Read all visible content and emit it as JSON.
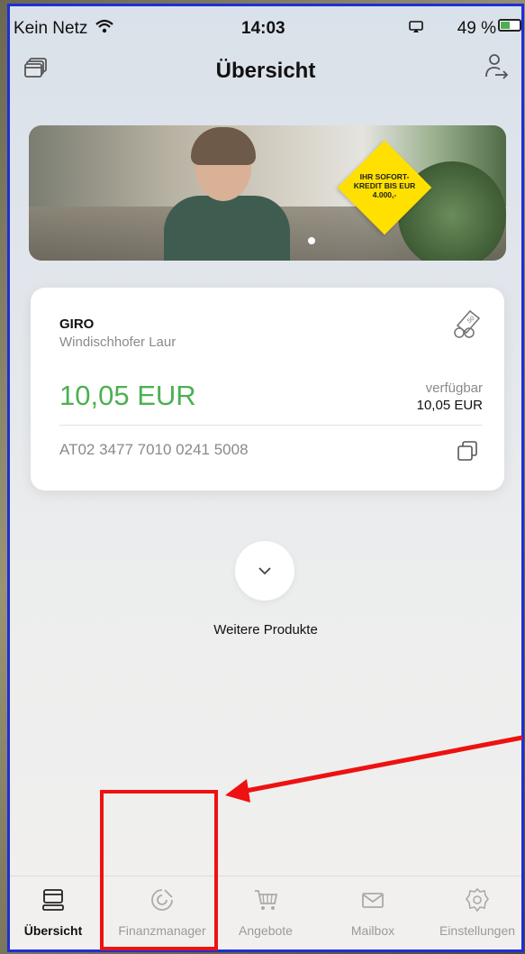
{
  "status_bar": {
    "network": "Kein Netz",
    "time": "14:03",
    "battery": "49 %"
  },
  "header": {
    "title": "Übersicht",
    "left_icon": "accounts-icon",
    "right_icon": "logout-icon"
  },
  "banner": {
    "badge_text": "IHR SOFORT-KREDIT BIS EUR 4.000,-"
  },
  "account": {
    "type": "GIRO",
    "owner": "Windischhofer Laur",
    "balance": "10,05 EUR",
    "available_label": "verfügbar",
    "available_value": "10,05 EUR",
    "iban": "AT02 3477 7010 0241 5008"
  },
  "more_products": {
    "label": "Weitere Produkte"
  },
  "tabbar": {
    "items": [
      {
        "label": "Übersicht",
        "icon": "overview-icon",
        "active": true
      },
      {
        "label": "Finanzmanager",
        "icon": "finance-manager-icon",
        "active": false
      },
      {
        "label": "Angebote",
        "icon": "cart-icon",
        "active": false
      },
      {
        "label": "Mailbox",
        "icon": "mail-icon",
        "active": false
      },
      {
        "label": "Einstellungen",
        "icon": "settings-icon",
        "active": false
      }
    ]
  },
  "colors": {
    "accent_green": "#4cb052",
    "annotation_red": "#ee1111",
    "frame_blue": "#1e2fd6",
    "badge_yellow": "#ffe000"
  }
}
